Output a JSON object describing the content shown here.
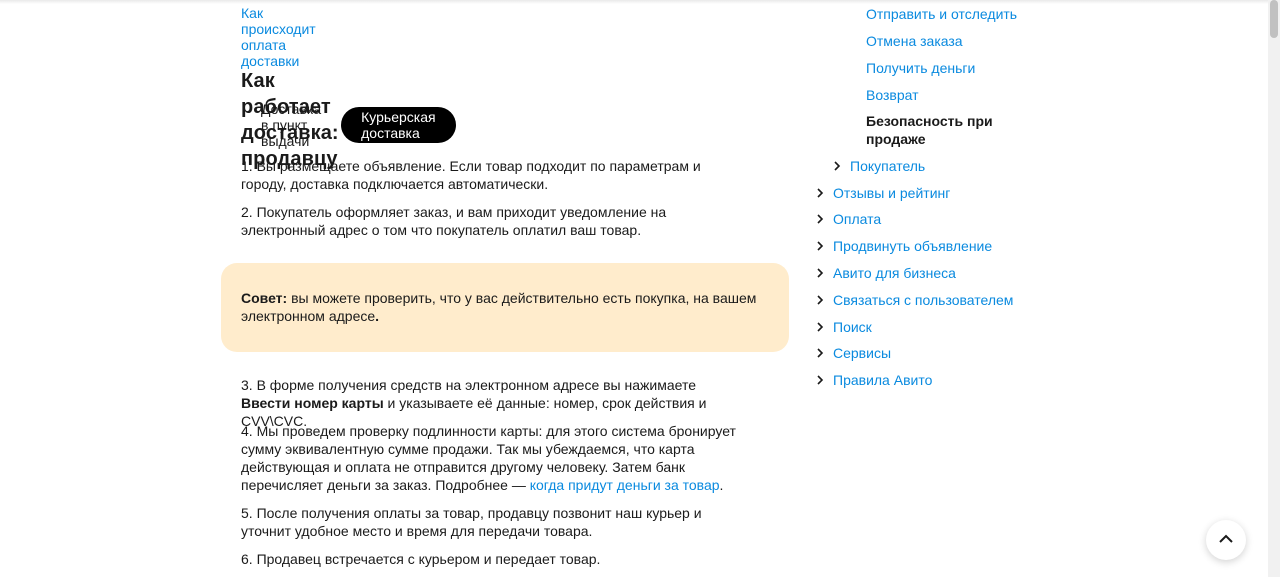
{
  "main": {
    "top_link": "Как происходит оплата доставки",
    "title": "Как работает доставка: продавцу",
    "tabs": [
      {
        "label": "Доставка в пункт выдачи",
        "active": false
      },
      {
        "label": "Курьерская доставка",
        "active": true
      }
    ],
    "step1": "1. Вы размещаете объявление. Если товар подходит по параметрам и городу, доставка подключается автоматически.",
    "step2": "2. Покупатель оформляет заказ, и вам приходит уведомление на электронный адрес о том что покупатель оплатил ваш товар.",
    "tip": {
      "label": "Совет:",
      "text": " вы можете проверить, что у вас действительно есть покупка, на вашем электронном адресе",
      "end": "."
    },
    "step3": {
      "before": "3. В форме получения средств на электронном адресе вы нажимаете ",
      "bold": "Ввести номер карты",
      "after": " и указываете её данные: номер, срок действия и CVV\\CVC."
    },
    "step4": {
      "text": "4. Мы проведем проверку подлинности карты: для этого система бронирует сумму эквивалентную сумме продажи. Так мы убеждаемся, что карта действующая и оплата не отправится другому человеку. Затем банк перечисляет деньги за заказ. Подробнее — ",
      "link": "когда придут деньги за товар",
      "end": "."
    },
    "step5": "5. После получения оплаты за товар, продавцу позвонит наш курьер и уточнит удобное место и время для передачи товара.",
    "step6": "6. Продавец встречается с курьером и передает товар."
  },
  "sidebar": {
    "sub_items": [
      "Отправить и отследить",
      "Отмена заказа",
      "Получить деньги",
      "Возврат"
    ],
    "active_item": "Безопасность при продаже",
    "buyer_item": "Покупатель",
    "items": [
      "Отзывы и рейтинг",
      "Оплата",
      "Продвинуть объявление",
      "Авито для бизнеса",
      "Связаться с пользователем",
      "Поиск",
      "Сервисы",
      "Правила Авито"
    ]
  },
  "icons": {
    "chevron": "chevron-right-icon",
    "scroll_top": "chevron-up-icon"
  },
  "colors": {
    "link": "#0a8adf",
    "tip_background": "#ffeccc",
    "active_tab": "#000000"
  }
}
